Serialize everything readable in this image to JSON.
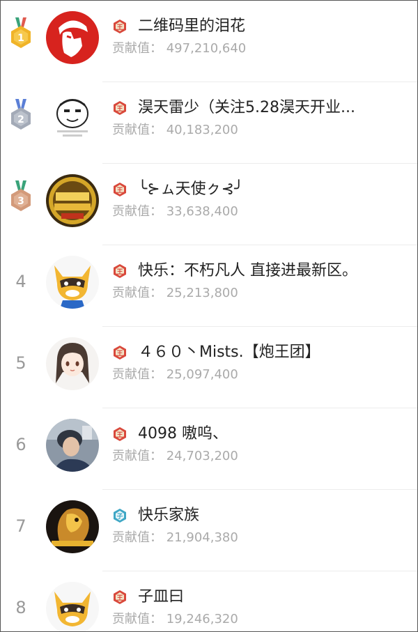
{
  "contribution_label": "贡献值：",
  "colors": {
    "gold": "#f0b429",
    "silver": "#a3aab7",
    "bronze": "#d39a7a",
    "badge_red": "#d9493c",
    "badge_teal": "#3fa7c5"
  },
  "ranking": [
    {
      "rank": "1",
      "medal": "gold-medal-icon",
      "badge": "red-level-badge-icon",
      "name": "二维码里的泪花",
      "value": "497,210,640"
    },
    {
      "rank": "2",
      "medal": "silver-medal-icon",
      "badge": "red-level-badge-icon",
      "name": "淏天雷少（关注5.28淏天开业...",
      "value": "40,183,200"
    },
    {
      "rank": "3",
      "medal": "bronze-medal-icon",
      "badge": "red-level-badge-icon",
      "name": "╰⊱ㇺ天使ㇰ⊰╯",
      "value": "33,638,400"
    },
    {
      "rank": "4",
      "badge": "red-level-badge-icon",
      "name": "快乐：不朽凡人 直接进最新区。",
      "value": "25,213,800"
    },
    {
      "rank": "5",
      "badge": "red-level-badge-icon",
      "name": "４６０丶Mists.【炮王团】",
      "value": "25,097,400"
    },
    {
      "rank": "6",
      "badge": "red-level-badge-icon",
      "name": "4098 嗷呜、",
      "value": "24,703,200"
    },
    {
      "rank": "7",
      "badge": "teal-level-badge-icon",
      "name": "快乐家族",
      "value": "21,904,380"
    },
    {
      "rank": "8",
      "badge": "red-level-badge-icon",
      "name": "子皿曰",
      "value": "19,246,320"
    }
  ]
}
